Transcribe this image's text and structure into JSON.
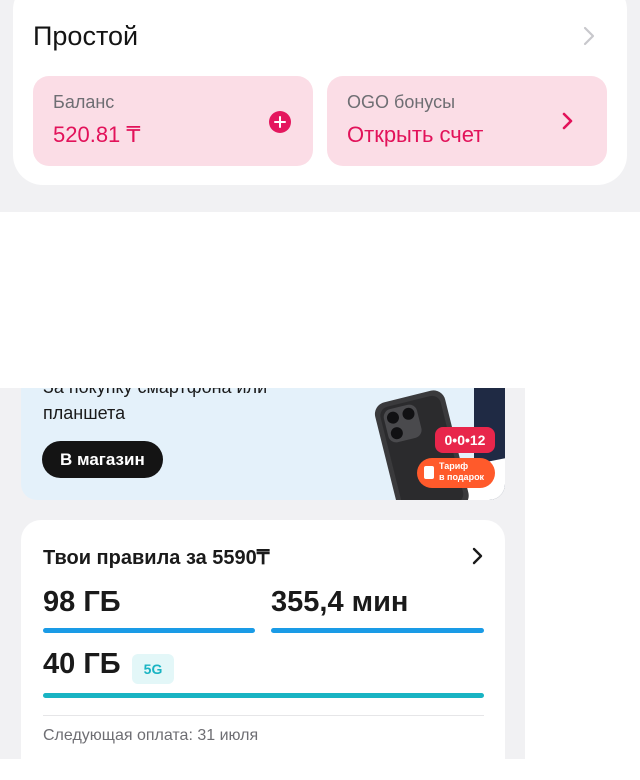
{
  "tariff": {
    "name": "Простой"
  },
  "balance": {
    "caption": "Баланс",
    "value": "520.81 ₸"
  },
  "bonus": {
    "caption": "OGO бонусы",
    "action": "Открыть счет"
  },
  "promo": {
    "line1": "За покупку смартфона или",
    "line2": "планшета",
    "button": "В магазин",
    "badge_number": "0•0•12",
    "gift_line1": "Тариф",
    "gift_line2": "в подарок"
  },
  "plan": {
    "title": "Твои правила за 5590₸",
    "data_amount": "98 ГБ",
    "minutes_amount": "355,4 мин",
    "data_5g_amount": "40 ГБ",
    "tag_5g": "5G",
    "next_payment": "Следующая оплата: 31 июля"
  },
  "colors": {
    "accent_pink": "#e2125a",
    "tile_pink": "#fbdde6",
    "progress_blue": "#1a9be6",
    "progress_teal": "#19b4c3"
  },
  "icons": {
    "tariff_chevron": "chevron-right-icon",
    "balance_add": "plus-circle-icon",
    "bonus_chevron": "chevron-right-icon",
    "plan_chevron": "chevron-right-icon"
  }
}
